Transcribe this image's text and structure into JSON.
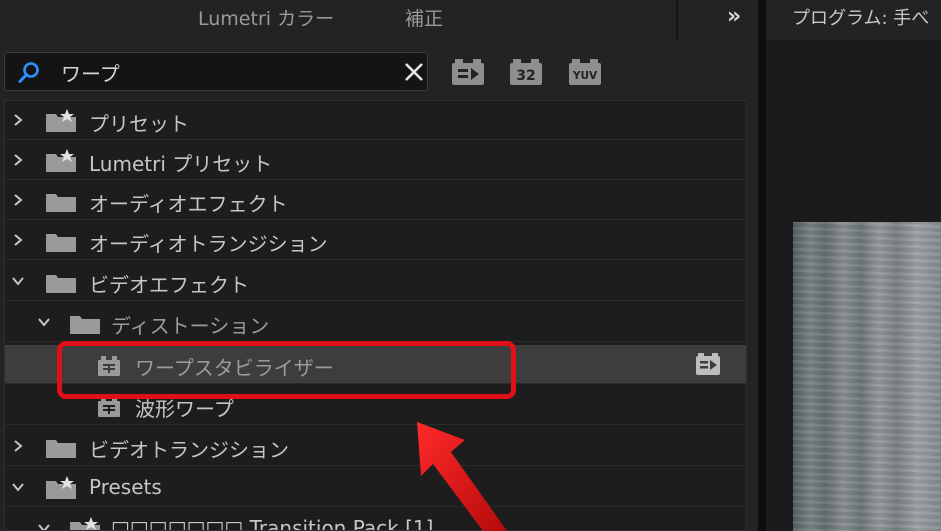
{
  "tabs": {
    "lumetri": "Lumetri カラー",
    "correct": "補正"
  },
  "overflow_label": "»",
  "monitor": {
    "title": "プログラム: 手べ"
  },
  "search": {
    "value": "ワープ",
    "placeholder": ""
  },
  "filters": {
    "accelerated": "accelerated-effects-icon",
    "bit32": "32",
    "yuv": "YUV"
  },
  "tree": {
    "items": [
      {
        "label": "プリセット",
        "expanded": false,
        "icon": "preset-folder-icon"
      },
      {
        "label": "Lumetri プリセット",
        "expanded": false,
        "icon": "preset-folder-icon"
      },
      {
        "label": "オーディオエフェクト",
        "expanded": false,
        "icon": "folder-icon"
      },
      {
        "label": "オーディオトランジション",
        "expanded": false,
        "icon": "folder-icon"
      },
      {
        "label": "ビデオエフェクト",
        "expanded": true,
        "icon": "folder-icon"
      },
      {
        "label": "ディストーション",
        "expanded": true,
        "icon": "folder-icon"
      },
      {
        "label": "ワープスタビライザー",
        "selected": true,
        "icon": "effect-icon",
        "badge": "accelerated-effects-icon"
      },
      {
        "label": "波形ワープ",
        "icon": "effect-icon"
      },
      {
        "label": "ビデオトランジション",
        "expanded": false,
        "icon": "folder-icon"
      },
      {
        "label": "Presets",
        "expanded": true,
        "icon": "preset-folder-icon"
      },
      {
        "label": "□□□□□□□ Transition Pack [1]",
        "expanded": true,
        "icon": "preset-folder-icon"
      }
    ]
  },
  "annotation": {
    "color": "#e0101a"
  }
}
